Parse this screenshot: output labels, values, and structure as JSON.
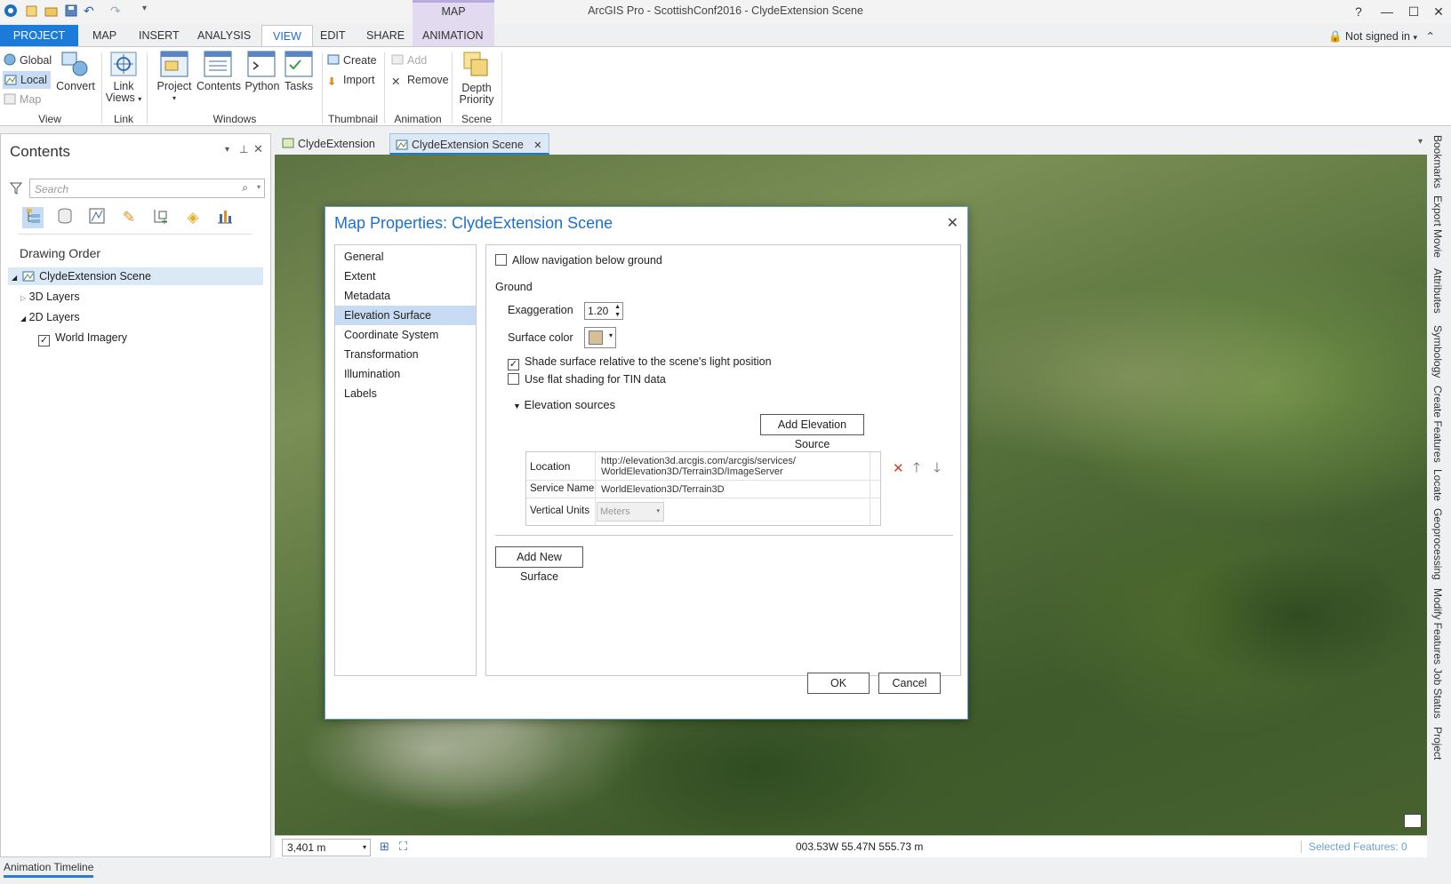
{
  "window": {
    "title": "ArcGIS Pro - ScottishConf2016 - ClydeExtension Scene",
    "contextual_tab_group": "MAP",
    "help": "?",
    "minimize": "—",
    "maximize": "☐",
    "close": "✕"
  },
  "ribbon": {
    "tabs": [
      "PROJECT",
      "MAP",
      "INSERT",
      "ANALYSIS",
      "VIEW",
      "EDIT",
      "SHARE",
      "ANIMATION"
    ],
    "active_tab": "VIEW",
    "signin": "Not signed in",
    "groups": {
      "view": {
        "label": "View",
        "global": "Global",
        "local": "Local",
        "map": "Map",
        "convert": "Convert"
      },
      "link": {
        "label": "Link",
        "link_views_1": "Link",
        "link_views_2": "Views"
      },
      "windows": {
        "label": "Windows",
        "project": "Project",
        "contents": "Contents",
        "python": "Python",
        "tasks": "Tasks"
      },
      "thumbnail": {
        "label": "Thumbnail",
        "create": "Create",
        "import": "Import"
      },
      "animation": {
        "label": "Animation",
        "add": "Add",
        "remove": "Remove"
      },
      "scene": {
        "label": "Scene",
        "depth_priority_1": "Depth",
        "depth_priority_2": "Priority"
      }
    }
  },
  "contents": {
    "title": "Contents",
    "search_placeholder": "Search",
    "section": "Drawing Order",
    "tree": {
      "scene": "ClydeExtension Scene",
      "layers3d": "3D Layers",
      "layers2d": "2D Layers",
      "world_imagery": "World Imagery"
    }
  },
  "view_tabs": [
    "ClydeExtension",
    "ClydeExtension Scene"
  ],
  "status": {
    "scale": "3,401 m",
    "coords": "003.53W 55.47N   555.73 m",
    "selected": "Selected Features: 0"
  },
  "right_dock": [
    "Bookmarks",
    "Export Movie",
    "Attributes",
    "Symbology",
    "Create Features",
    "Locate",
    "Geoprocessing",
    "Modify Features",
    "Job Status",
    "Project"
  ],
  "bottom_tab": "Animation Timeline",
  "dialog": {
    "title": "Map Properties: ClydeExtension Scene",
    "nav": [
      "General",
      "Extent",
      "Metadata",
      "Elevation Surface",
      "Coordinate System",
      "Transformation",
      "Illumination",
      "Labels"
    ],
    "selected_nav": "Elevation Surface",
    "allow_navigation": "Allow navigation below ground",
    "ground": "Ground",
    "exaggeration_label": "Exaggeration",
    "exaggeration_value": "1.20",
    "surface_color_label": "Surface color",
    "surface_color": "#d8c096",
    "shade_surface": "Shade surface relative to the scene's light position",
    "flat_shading": "Use flat shading for TIN data",
    "elevation_sources": "Elevation sources",
    "add_elevation_source": "Add Elevation Source",
    "source": {
      "location_label": "Location",
      "location_value_1": "http://elevation3d.arcgis.com/arcgis/services/",
      "location_value_2": "WorldElevation3D/Terrain3D/ImageServer",
      "service_name_label": "Service Name",
      "service_name_value": "WorldElevation3D/Terrain3D",
      "vertical_units_label": "Vertical Units",
      "vertical_units_value": "Meters"
    },
    "add_new_surface": "Add New Surface",
    "ok": "OK",
    "cancel": "Cancel"
  }
}
